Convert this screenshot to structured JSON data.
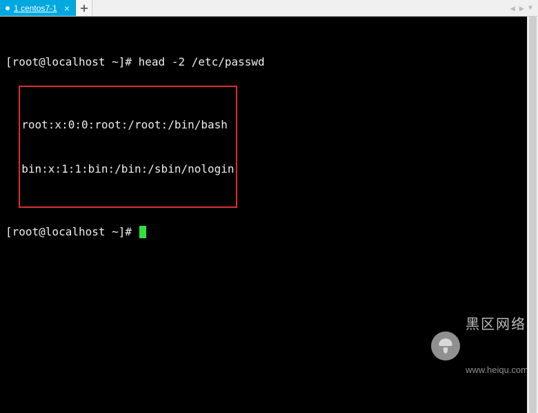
{
  "tab": {
    "label": "1 centos7-1",
    "close_glyph": "×"
  },
  "terminal": {
    "line1_prompt": "[root@localhost ~]# ",
    "line1_cmd": "head -2 /etc/passwd",
    "output": [
      "root:x:0:0:root:/root:/bin/bash",
      "bin:x:1:1:bin:/bin:/sbin/nologin"
    ],
    "line2_prompt": "[root@localhost ~]# "
  },
  "watermark": {
    "title": "黑区网络",
    "url": "www.heiqu.com"
  }
}
